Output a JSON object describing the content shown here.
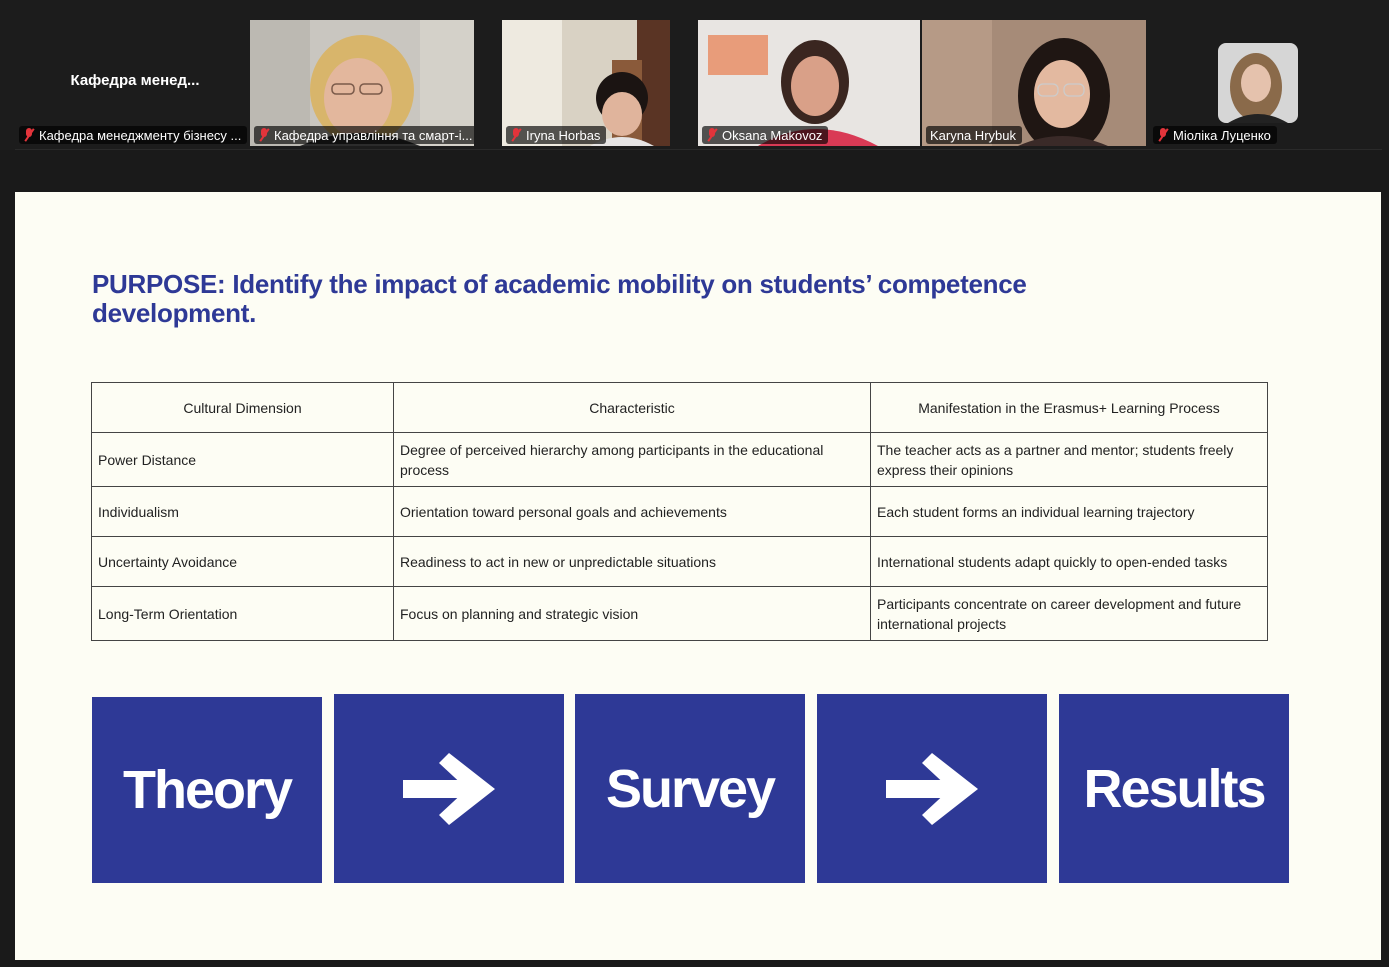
{
  "participants": {
    "textonly": {
      "display": "Кафедра  менед...",
      "tag": "Кафедра менеджменту бізнесу ..."
    },
    "tiles": [
      {
        "name": "Кафедра управління та смарт-і...",
        "muted": true
      },
      {
        "name": "Iryna Horbas",
        "muted": true
      },
      {
        "name": "Oksana Makovoz",
        "muted": true
      },
      {
        "name": "Karyna Hrybuk",
        "muted": false,
        "active": true
      },
      {
        "name": "Міоліка Луценко",
        "muted": true
      }
    ]
  },
  "slide": {
    "purpose": "PURPOSE: Identify the impact of academic mobility on students’ competence development.",
    "table": {
      "headers": [
        "Cultural Dimension",
        "Characteristic",
        "Manifestation in the Erasmus+ Learning Process"
      ],
      "rows": [
        [
          "Power Distance",
          "Degree of perceived hierarchy among participants in the educational process",
          "The teacher acts as a partner and mentor; students freely express their opinions"
        ],
        [
          "Individualism",
          "Orientation toward personal goals and achievements",
          "Each student forms an individual learning trajectory"
        ],
        [
          "Uncertainty Avoidance",
          "Readiness to act in new or unpredictable situations",
          "International students adapt quickly to open-ended tasks"
        ],
        [
          "Long-Term Orientation",
          "Focus on planning and strategic vision",
          "Participants concentrate on career development and future international projects"
        ]
      ]
    },
    "flow": [
      "Theory",
      "Survey",
      "Results"
    ],
    "accent_color": "#2e3996"
  }
}
